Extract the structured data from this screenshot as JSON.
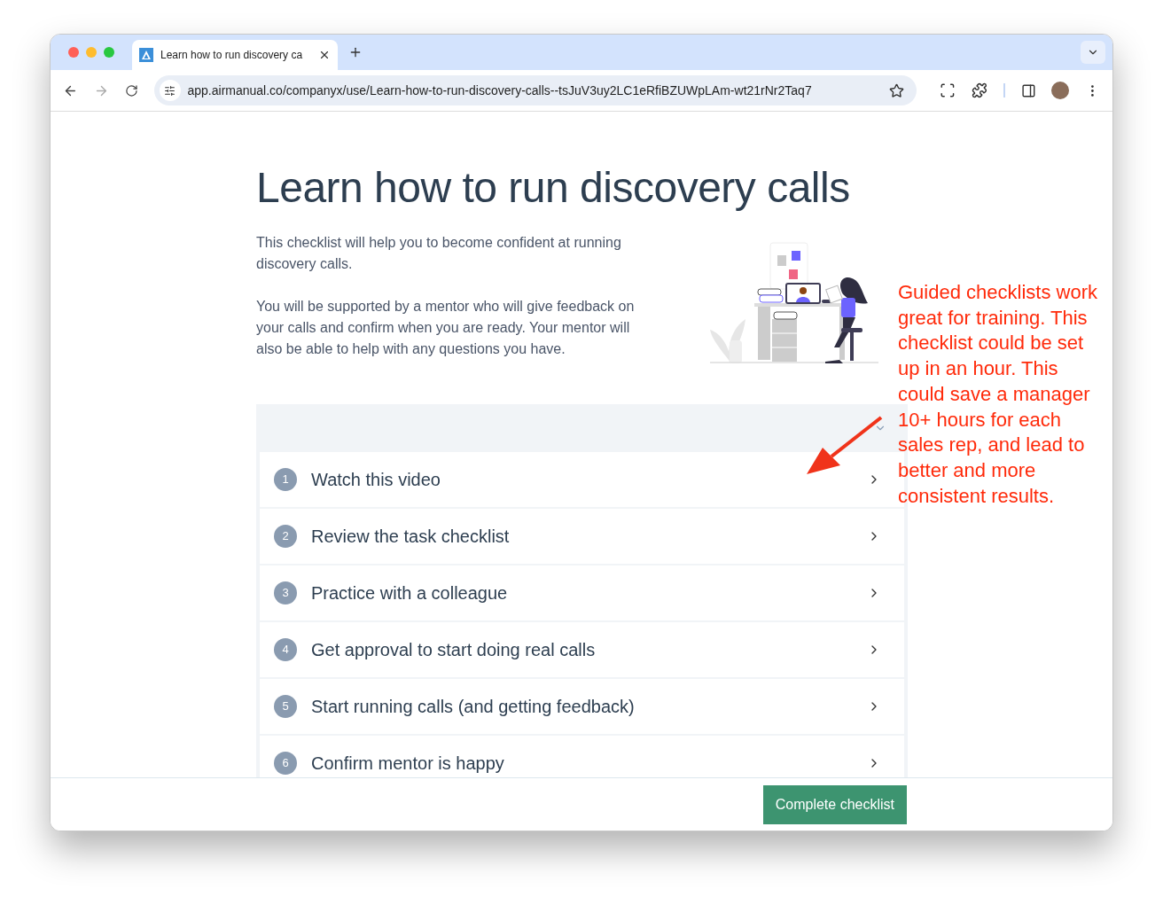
{
  "browser": {
    "tab_title": "Learn how to run discovery ca",
    "url": "app.airmanual.co/companyx/use/Learn-how-to-run-discovery-calls--tsJuV3uy2LC1eRfiBZUWpLAm-wt21rNr2Taq7"
  },
  "page": {
    "title": "Learn how to run discovery calls",
    "paragraphs": [
      "This checklist will help you to become confident at running discovery calls.",
      "You will be supported by a mentor who will give feedback on your calls and confirm when you are ready. Your mentor will also be able to help with any questions you have."
    ]
  },
  "checklist": {
    "items": [
      {
        "number": "1",
        "label": "Watch this video"
      },
      {
        "number": "2",
        "label": "Review the task checklist"
      },
      {
        "number": "3",
        "label": "Practice with a colleague"
      },
      {
        "number": "4",
        "label": "Get approval to start doing real calls"
      },
      {
        "number": "5",
        "label": "Start running calls (and getting feedback)"
      },
      {
        "number": "6",
        "label": "Confirm mentor is happy"
      }
    ]
  },
  "footer": {
    "button": "Complete checklist"
  },
  "annotation": "Guided checklists work great for training. This checklist could be set up in an hour. This could save a manager 10+ hours for each sales rep, and lead to better and more consistent results."
}
